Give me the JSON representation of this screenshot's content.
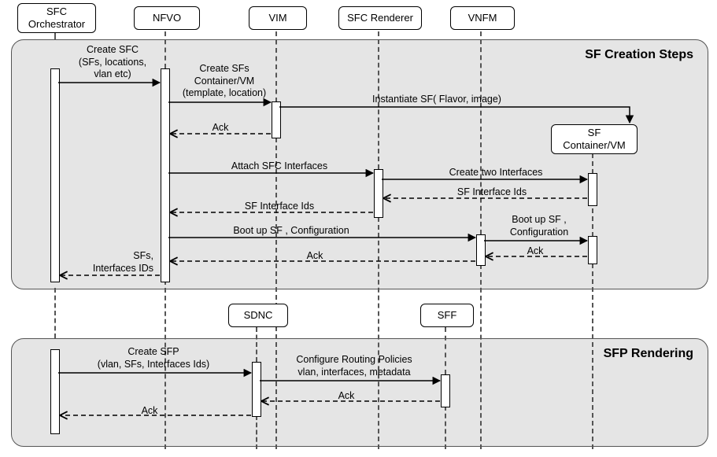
{
  "participants": {
    "sfc_orchestrator": "SFC\nOrchestrator",
    "nfvo": "NFVO",
    "vim": "VIM",
    "sfc_renderer": "SFC Renderer",
    "vnfm": "VNFM",
    "sdnc": "SDNC",
    "sff": "SFF",
    "sf_container": "SF\nContainer/VM"
  },
  "panels": {
    "creation_title": "SF Creation Steps",
    "rendering_title": "SFP Rendering"
  },
  "msgs": {
    "create_sfc": "Create SFC\n(SFs, locations,\nvlan etc)",
    "create_sfs_container": "Create SFs\nContainer/VM\n(template, location)",
    "instantiate_sf": "Instantiate SF( Flavor, image)",
    "ack": "Ack",
    "attach_sfc_if": "Attach SFC Interfaces",
    "create_two_if": "Create two Interfaces",
    "sf_if_ids": "SF Interface Ids",
    "bootup_sf": "Boot up SF , Configuration",
    "bootup_sf2": "Boot up SF ,\nConfiguration",
    "sfs_interfaces_ids": "SFs,\nInterfaces IDs",
    "create_sfp": "Create SFP\n(vlan, SFs, Interfaces Ids)",
    "configure_routing": "Configure Routing Policies\nvlan, interfaces, metadata"
  }
}
